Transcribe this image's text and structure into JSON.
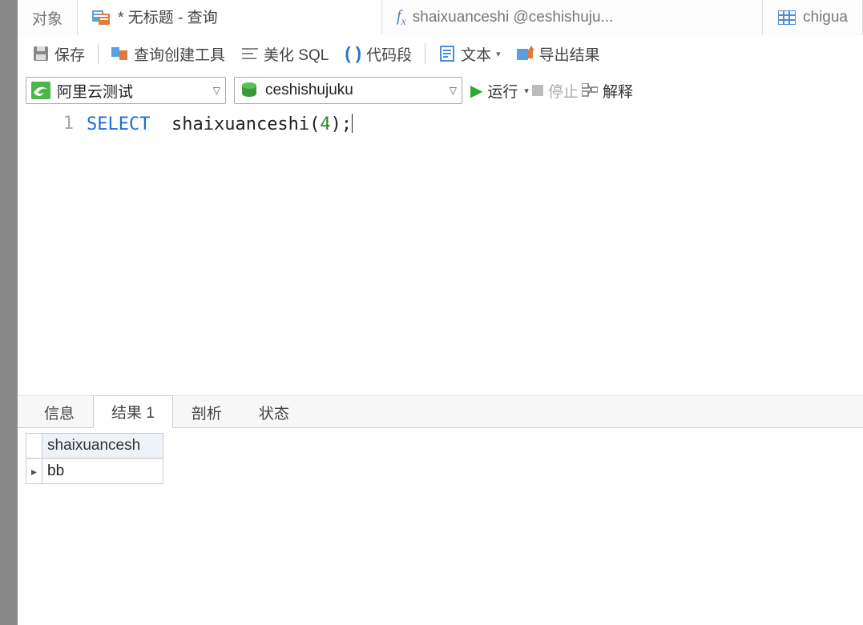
{
  "top_tabs": {
    "objects": "对象",
    "active": "* 无标题 - 查询",
    "fx_label": "shaixuanceshi @ceshishuju...",
    "chigua": "chigua"
  },
  "toolbar": {
    "save": "保存",
    "query_builder": "查询创建工具",
    "beautify": "美化 SQL",
    "snippet": "代码段",
    "text": "文本",
    "export": "导出结果"
  },
  "selectors": {
    "connection": "阿里云测试",
    "database": "ceshishujuku",
    "run": "运行",
    "stop": "停止",
    "explain": "解释"
  },
  "editor": {
    "line_no": "1",
    "kw": "SELECT",
    "fn": "shaixuanceshi",
    "lp": "(",
    "arg": "4",
    "rp": ")",
    "semi": ";"
  },
  "result_tabs": {
    "info": "信息",
    "result": "结果 1",
    "profile": "剖析",
    "status": "状态"
  },
  "result": {
    "column": "shaixuancesh",
    "rows": [
      "bb"
    ]
  }
}
